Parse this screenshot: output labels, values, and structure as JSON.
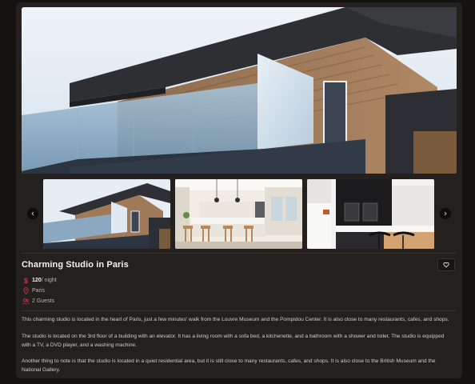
{
  "listing": {
    "title": "Charming Studio in Paris",
    "price": "120",
    "price_unit": " / night",
    "location": "Paris",
    "guests": "2 Guests",
    "description": [
      "This charming studio is located in the heart of Paris, just a few minutes' walk from the Louvre Museum and the Pompidou Center. It is also close to many restaurants, cafes, and shops.",
      "The studio is located on the 3rd floor of a building with an elevator. It has a living room with a sofa bed, a kitchenette, and a bathroom with a shower and toilet. The studio is equipped with a TV, a DVD player, and a washing machine.",
      "Another thing to note is that the studio is located in a quiet residential area, but it is still close to many restaurants, cafes, and shops. It is also close to the British Museum and the National Gallery."
    ]
  },
  "icons": {
    "price": "dollar-icon",
    "location": "map-pin-icon",
    "guests": "users-icon",
    "favorite": "heart-icon",
    "prev": "chevron-left-icon",
    "next": "chevron-right-icon"
  },
  "colors": {
    "background": "#151312",
    "card": "#24201e",
    "accent": "#c0394a",
    "title": "#f4f1ee"
  }
}
